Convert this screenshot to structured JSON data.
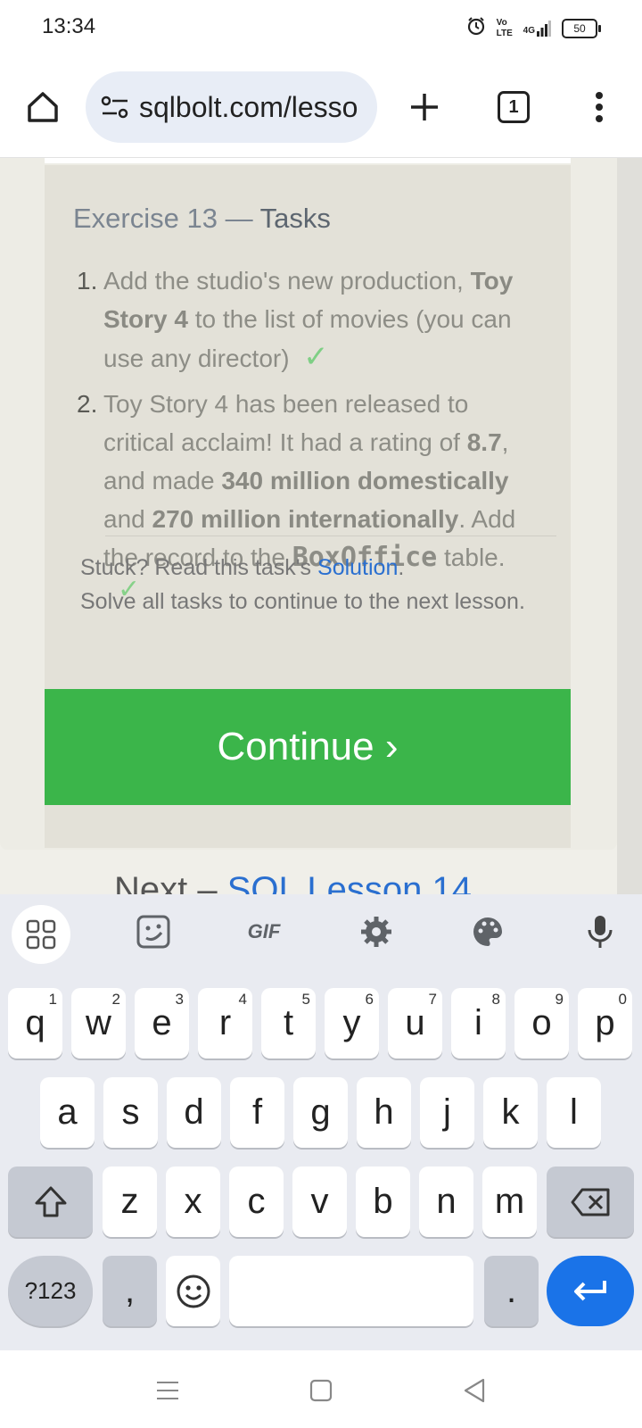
{
  "status_bar": {
    "time": "13:34",
    "network_label": "4G",
    "volte_label": "Vo LTE",
    "battery": "50"
  },
  "browser": {
    "url": "sqlbolt.com/lesso",
    "tab_count": "1",
    "icons": [
      "home-icon",
      "site-settings-icon",
      "plus-icon",
      "tab-switcher-icon",
      "overflow-menu-icon"
    ]
  },
  "exercise": {
    "title_prefix": "Exercise 13 — ",
    "title_suffix": "Tasks",
    "task1": {
      "number": "1.",
      "line1_pre": "Add the studio's new production, ",
      "line1_bold": "Toy",
      "line2_bold": "Story 4",
      "line2_post": " to the list of movies (you can",
      "line3": "use any director)",
      "check": "✓"
    },
    "task2": {
      "number": "2.",
      "line1": "Toy Story 4 has been released to",
      "line2_pre": "critical acclaim! It had a rating of ",
      "line2_bold": "8.7",
      "line2_post": ",",
      "line3_pre": "and made ",
      "line3_bold": "340 million domestically",
      "line4_pre": "and ",
      "line4_bold": "270 million internationally",
      "line4_post": ". Add",
      "line5_pre": "the record to the ",
      "line5_code": "BoxOffice",
      "line5_post": " table."
    },
    "stuck_pre": "Stuck? Read this task's ",
    "stuck_link": "Solution",
    "stuck_post": ".",
    "solve_all": "Solve all tasks to continue to the next lesson.",
    "check2": "✓",
    "continue_label": "Continue ›"
  },
  "next_peek": {
    "pre": "Next – ",
    "link": "SQL Lesson 14"
  },
  "keyboard": {
    "row1": [
      {
        "k": "q",
        "s": "1"
      },
      {
        "k": "w",
        "s": "2"
      },
      {
        "k": "e",
        "s": "3"
      },
      {
        "k": "r",
        "s": "4"
      },
      {
        "k": "t",
        "s": "5"
      },
      {
        "k": "y",
        "s": "6"
      },
      {
        "k": "u",
        "s": "7"
      },
      {
        "k": "i",
        "s": "8"
      },
      {
        "k": "o",
        "s": "9"
      },
      {
        "k": "p",
        "s": "0"
      }
    ],
    "row2": [
      "a",
      "s",
      "d",
      "f",
      "g",
      "h",
      "j",
      "k",
      "l"
    ],
    "row3": [
      "z",
      "x",
      "c",
      "v",
      "b",
      "n",
      "m"
    ],
    "symbols_label": "?123",
    "comma": ",",
    "period": ".",
    "gif_label": "GIF",
    "accent_color": "#1a73e8"
  },
  "colors": {
    "continue_bg": "#3bb54a",
    "link": "#2a6fd0",
    "panel_bg": "#e3e1d8"
  }
}
